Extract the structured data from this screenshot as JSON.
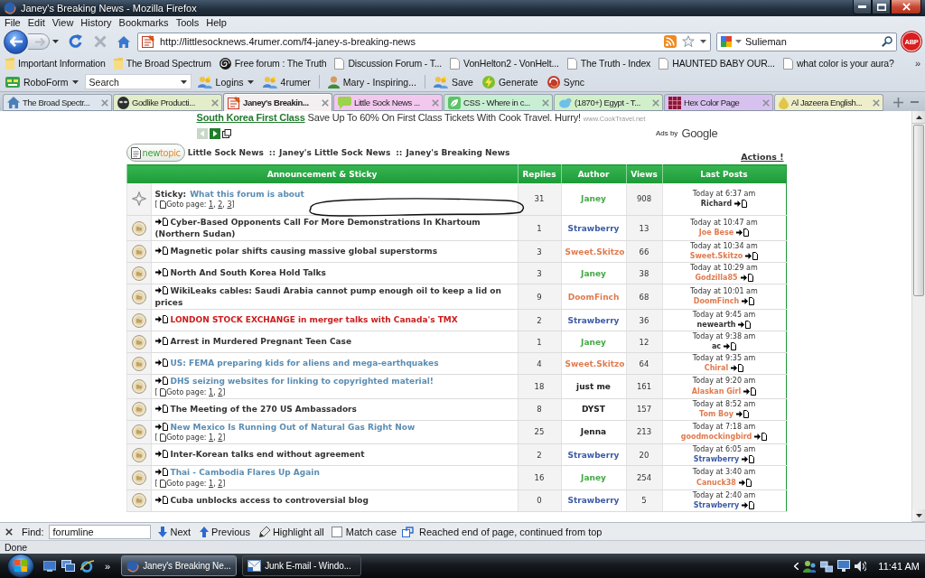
{
  "window": {
    "title": "Janey's Breaking News - Mozilla Firefox"
  },
  "menu": [
    "File",
    "Edit",
    "View",
    "History",
    "Bookmarks",
    "Tools",
    "Help"
  ],
  "navigation": {
    "url": "http://littlesocknews.4rumer.com/f4-janey-s-breaking-news",
    "search": "Sulieman",
    "adblock": "ABP"
  },
  "bookmarks": {
    "items": [
      {
        "kind": "folder",
        "label": "Important Information"
      },
      {
        "kind": "folder",
        "label": "The Broad Spectrum"
      },
      {
        "kind": "spiral",
        "label": "Free forum : The Truth"
      },
      {
        "kind": "page",
        "label": "Discussion Forum - T..."
      },
      {
        "kind": "page",
        "label": "VonHelton2 - VonHelt..."
      },
      {
        "kind": "page",
        "label": "The Truth - Index"
      },
      {
        "kind": "page",
        "label": "HAUNTED BABY OUR..."
      },
      {
        "kind": "page",
        "label": "what color is your aura?"
      }
    ],
    "overflow": "»"
  },
  "addon_toolbar": [
    {
      "kind": "roboform",
      "label": "RoboForm"
    },
    {
      "kind": "search",
      "placeholder": "Search"
    },
    {
      "kind": "logins",
      "label": "Logins"
    },
    {
      "kind": "site",
      "label": "4rumer"
    },
    {
      "kind": "separator"
    },
    {
      "kind": "person",
      "label": "Mary - Inspiring..."
    },
    {
      "kind": "separator"
    },
    {
      "kind": "save",
      "label": "Save"
    },
    {
      "kind": "generate",
      "label": "Generate"
    },
    {
      "kind": "sync",
      "label": "Sync"
    }
  ],
  "tabs": [
    {
      "kind": "home",
      "label": "The Broad Spectr...",
      "selected": false,
      "color": "#dde5ee"
    },
    {
      "kind": "alien",
      "label": "Godlike Producti...",
      "selected": false,
      "color": "#e3edc9"
    },
    {
      "kind": "notepad",
      "label": "Janey's Breakin...",
      "selected": true,
      "color": "#f4eff1"
    },
    {
      "kind": "bubble",
      "label": "Little Sock News ...",
      "selected": false,
      "color": "#f2c8ee"
    },
    {
      "kind": "tile",
      "label": "CSS - Where in c...",
      "selected": false,
      "color": "#c8eed3"
    },
    {
      "kind": "bird",
      "label": "(1870+) Egypt - T...",
      "selected": false,
      "color": "#d2efcb"
    },
    {
      "kind": "grid",
      "label": "Hex Color Page",
      "selected": false,
      "color": "#d7c2ef"
    },
    {
      "kind": "drop",
      "label": "Al Jazeera English...",
      "selected": false,
      "color": "#eeeeca"
    }
  ],
  "ad": {
    "link": "South Korea First Class",
    "text": "Save Up To 60% On First Class Tickets With Cook Travel. Hurry!",
    "url": "www.CookTravel.net",
    "attribution": "Ads by",
    "brand": "Google"
  },
  "forum": {
    "new_topic": [
      "new",
      "topic"
    ],
    "breadcrumb": [
      {
        "label": "Little Sock News"
      },
      {
        "separator": "::",
        "label": "Janey's Little Sock News"
      },
      {
        "separator": "::",
        "label": "Janey's Breaking News"
      }
    ],
    "actions": "Actions !"
  },
  "table": {
    "columns": [
      "Announcement & Sticky",
      "Replies",
      "Author",
      "Views",
      "Last Posts"
    ],
    "topics": [
      {
        "kind": "sticky",
        "prefix": "Sticky:",
        "title": {
          "text": "What this forum is about",
          "color": "#5b8db3"
        },
        "goto": {
          "open": "[",
          "label": "Goto page:",
          "pages": [
            {
              "number": "1",
              "separator": ","
            },
            {
              "number": "2",
              "separator": ","
            },
            {
              "number": "3"
            }
          ],
          "close": "]"
        },
        "replies": "31",
        "author": {
          "name": "Janey",
          "color": "#45a845"
        },
        "views": "908",
        "last_post": {
          "time": "Today at 6:37 am",
          "user": {
            "name": "Richard",
            "color": "#333333"
          }
        }
      },
      {
        "kind": "topic",
        "title": {
          "text": "Cyber-Based Opponents Call For More Demonstrations In Khartoum (Northern Sudan)",
          "color": "#333333"
        },
        "replies": "1",
        "author": {
          "name": "Strawberry",
          "color": "#3d5ba6"
        },
        "views": "13",
        "last_post": {
          "time": "Today at 10:47 am",
          "user": {
            "name": "Joe Bese",
            "color": "#e07b4f"
          }
        }
      },
      {
        "kind": "topic",
        "title": {
          "text": "Magnetic polar shifts causing massive global superstorms",
          "color": "#333333"
        },
        "replies": "3",
        "author": {
          "name": "Sweet.Skitzo",
          "color": "#e07b4f"
        },
        "views": "66",
        "last_post": {
          "time": "Today at 10:34 am",
          "user": {
            "name": "Sweet.Skitzo",
            "color": "#e07b4f"
          }
        }
      },
      {
        "kind": "topic",
        "title": {
          "text": "North And South Korea Hold Talks",
          "color": "#333333"
        },
        "replies": "3",
        "author": {
          "name": "Janey",
          "color": "#45a845"
        },
        "views": "38",
        "last_post": {
          "time": "Today at 10:29 am",
          "user": {
            "name": "Godzilla85",
            "color": "#e07b4f"
          }
        }
      },
      {
        "kind": "topic",
        "title": {
          "text": "WikiLeaks cables: Saudi Arabia cannot pump enough oil to keep a lid on prices",
          "color": "#333333"
        },
        "replies": "9",
        "author": {
          "name": "DoomFinch",
          "color": "#e07b4f"
        },
        "views": "68",
        "last_post": {
          "time": "Today at 10:01 am",
          "user": {
            "name": "DoomFinch",
            "color": "#e07b4f"
          }
        }
      },
      {
        "kind": "topic",
        "title": {
          "text": "LONDON STOCK EXCHANGE in merger talks with Canada's TMX",
          "color": "#cc1b1b"
        },
        "replies": "2",
        "author": {
          "name": "Strawberry",
          "color": "#3d5ba6"
        },
        "views": "36",
        "last_post": {
          "time": "Today at 9:45 am",
          "user": {
            "name": "newearth",
            "color": "#333333"
          }
        }
      },
      {
        "kind": "topic",
        "title": {
          "text": "Arrest in Murdered Pregnant Teen Case",
          "color": "#333333"
        },
        "replies": "1",
        "author": {
          "name": "Janey",
          "color": "#45a845"
        },
        "views": "12",
        "last_post": {
          "time": "Today at 9:38 am",
          "user": {
            "name": "ac",
            "color": "#333333"
          }
        }
      },
      {
        "kind": "topic",
        "title": {
          "text": "US: FEMA preparing kids for aliens and mega-earthquakes",
          "color": "#5b8db3"
        },
        "replies": "4",
        "author": {
          "name": "Sweet.Skitzo",
          "color": "#e07b4f"
        },
        "views": "64",
        "last_post": {
          "time": "Today at 9:35 am",
          "user": {
            "name": "Chiral",
            "color": "#e07b4f"
          }
        }
      },
      {
        "kind": "topic",
        "title": {
          "text": "DHS seizing websites for linking to copyrighted material!",
          "color": "#5b8db3"
        },
        "goto": {
          "open": "[",
          "label": "Goto page:",
          "pages": [
            {
              "number": "1",
              "separator": ","
            },
            {
              "number": "2"
            }
          ],
          "close": "]"
        },
        "replies": "18",
        "author": {
          "name": "just me",
          "color": "#222222"
        },
        "views": "161",
        "last_post": {
          "time": "Today at 9:20 am",
          "user": {
            "name": "Alaskan Girl",
            "color": "#e07b4f"
          }
        }
      },
      {
        "kind": "topic",
        "title": {
          "text": "The Meeting of the 270 US Ambassadors",
          "color": "#333333"
        },
        "replies": "8",
        "author": {
          "name": "DYST",
          "color": "#222222"
        },
        "views": "157",
        "last_post": {
          "time": "Today at 8:52 am",
          "user": {
            "name": "Tom Boy",
            "color": "#e07b4f"
          }
        }
      },
      {
        "kind": "topic",
        "title": {
          "text": "New Mexico Is Running Out of Natural Gas Right Now",
          "color": "#5b8db3"
        },
        "goto": {
          "open": "[",
          "label": "Goto page:",
          "pages": [
            {
              "number": "1",
              "separator": ","
            },
            {
              "number": "2"
            }
          ],
          "close": "]"
        },
        "replies": "25",
        "author": {
          "name": "Jenna",
          "color": "#222222"
        },
        "views": "213",
        "last_post": {
          "time": "Today at 7:18 am",
          "user": {
            "name": "goodmockingbird",
            "color": "#e07b4f"
          }
        }
      },
      {
        "kind": "topic",
        "title": {
          "text": "Inter-Korean talks end without agreement",
          "color": "#333333"
        },
        "replies": "2",
        "author": {
          "name": "Strawberry",
          "color": "#3d5ba6"
        },
        "views": "20",
        "last_post": {
          "time": "Today at 6:05 am",
          "user": {
            "name": "Strawberry",
            "color": "#3d5ba6"
          }
        }
      },
      {
        "kind": "topic",
        "title": {
          "text": "Thai - Cambodia Flares Up Again",
          "color": "#5b8db3"
        },
        "goto": {
          "open": "[",
          "label": "Goto page:",
          "pages": [
            {
              "number": "1",
              "separator": ","
            },
            {
              "number": "2"
            }
          ],
          "close": "]"
        },
        "replies": "16",
        "author": {
          "name": "Janey",
          "color": "#45a845"
        },
        "views": "254",
        "last_post": {
          "time": "Today at 3:40 am",
          "user": {
            "name": "Canuck38",
            "color": "#e07b4f"
          }
        }
      },
      {
        "kind": "topic",
        "title": {
          "text": "Cuba unblocks access to controversial blog",
          "color": "#333333"
        },
        "replies": "0",
        "author": {
          "name": "Strawberry",
          "color": "#3d5ba6"
        },
        "views": "5",
        "last_post": {
          "time": "Today at 2:40 am",
          "user": {
            "name": "Strawberry",
            "color": "#3d5ba6"
          }
        }
      }
    ]
  },
  "find_bar": {
    "label": "Find:",
    "value": "forumline",
    "next": "Next",
    "previous": "Previous",
    "highlight": "Highlight all",
    "match_case": {
      "label": "Match case",
      "checked": false
    },
    "message": "Reached end of page, continued from top"
  },
  "status_bar": "Done",
  "taskbar": {
    "overflow": "»",
    "tasks": [
      {
        "kind": "browser",
        "label": "Janey's Breaking Ne...",
        "selected": true
      },
      {
        "kind": "mail",
        "label": "Junk E-mail - Windo...",
        "selected": false
      }
    ],
    "clock": "11:41 AM"
  }
}
